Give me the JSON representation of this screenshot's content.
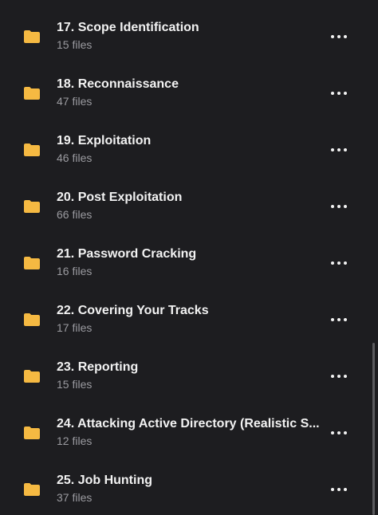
{
  "colors": {
    "background": "#1d1d20",
    "folder": "#f5b942",
    "title_text": "#f2f2f2",
    "subtitle_text": "#9b9ba0"
  },
  "icons": {
    "folder": "folder-icon",
    "more": "more-horizontal-icon"
  },
  "folders": [
    {
      "name": "17. Scope Identification",
      "count": "15 files"
    },
    {
      "name": "18. Reconnaissance",
      "count": "47 files"
    },
    {
      "name": "19. Exploitation",
      "count": "46 files"
    },
    {
      "name": "20. Post Exploitation",
      "count": "66 files"
    },
    {
      "name": "21. Password Cracking",
      "count": "16 files"
    },
    {
      "name": "22. Covering Your Tracks",
      "count": "17 files"
    },
    {
      "name": "23. Reporting",
      "count": "15 files"
    },
    {
      "name": "24. Attacking Active Directory (Realistic S...",
      "count": "12 files"
    },
    {
      "name": "25. Job Hunting",
      "count": "37 files"
    }
  ]
}
